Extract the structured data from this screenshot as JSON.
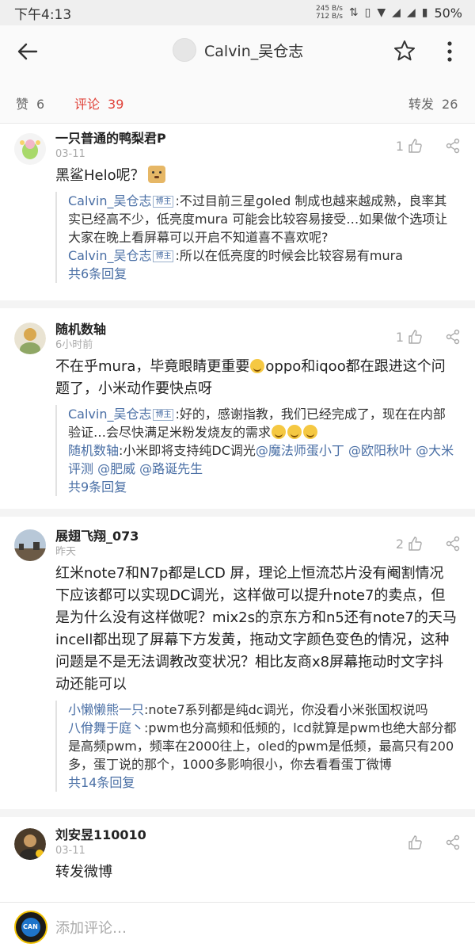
{
  "status_bar": {
    "time": "下午4:13",
    "net_up": "245 B/s",
    "net_down": "712 B/s",
    "battery": "50%"
  },
  "header": {
    "title": "Calvin_吴仓志"
  },
  "counts": {
    "like_label": "赞",
    "like_count": "6",
    "comment_label": "评论",
    "comment_count": "39",
    "repost_label": "转发",
    "repost_count": "26"
  },
  "comments": [
    {
      "name": "一只普通的鸭梨君P",
      "time": "03-11",
      "likes": "1",
      "text": "黑鲨Helo呢？",
      "replies": [
        {
          "name": "Calvin_吴仓志",
          "tag": "博主",
          "text": ":不过目前三星goled 制成也越来越成熟，良率其实已经高不少，低亮度mura 可能会比较容易接受…如果做个选项让大家在晚上看屏幕可以开启不知道喜不喜欢呢?"
        },
        {
          "name": "Calvin_吴仓志",
          "tag": "博主",
          "text": ":所以在低亮度的时候会比较容易有mura"
        }
      ],
      "more_replies": "共6条回复"
    },
    {
      "name": "随机数轴",
      "time": "6小时前",
      "likes": "1",
      "text_a": "不在乎mura，毕竟眼睛更重要",
      "text_b": "oppo和iqoo都在跟进这个问题了，小米动作要快点呀",
      "replies": [
        {
          "name": "Calvin_吴仓志",
          "tag": "博主",
          "text": ":好的，感谢指教，我们已经完成了，现在在内部验证…会尽快满足米粉发烧友的需求"
        },
        {
          "name": "随机数轴",
          "text": ":小米即将支持纯DC调光",
          "mentions": "@魔法师蛋小丁 @欧阳秋叶 @大米评测 @肥威 @路诞先生"
        }
      ],
      "more_replies": "共9条回复"
    },
    {
      "name": "展翅飞翔_073",
      "time": "昨天",
      "likes": "2",
      "text": "红米note7和N7p都是LCD 屏，理论上恒流芯片没有阉割情况下应该都可以实现DC调光，这样做可以提升note7的卖点，但是为什么没有这样做呢？mix2s的京东方和n5还有note7的天马incell都出现了屏幕下方发黄，拖动文字颜色变色的情况，这种问题是不是无法调教改变状况？相比友商x8屏幕拖动时文字抖动还能可以",
      "replies": [
        {
          "name": "小懒懒熊一只",
          "text": ":note7系列都是纯dc调光，你没看小米张国权说吗"
        },
        {
          "name": "八佾舞于庭丶",
          "text": ":pwm也分高频和低频的，lcd就算是pwm也绝大部分都是高频pwm，频率在2000往上，oled的pwm是低频，最高只有200多，蛋丁说的那个，1000多影响很小，你去看看蛋丁微博"
        }
      ],
      "more_replies": "共14条回复"
    },
    {
      "name": "刘安昱110010",
      "time": "03-11",
      "text": "转发微博"
    }
  ],
  "bottom": {
    "placeholder": "添加评论…",
    "avatar_label": "CAN"
  }
}
